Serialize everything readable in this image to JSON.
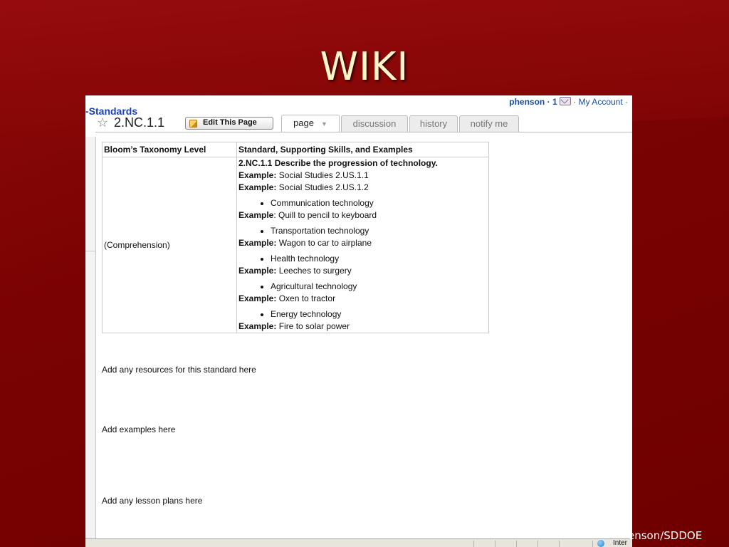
{
  "slide": {
    "title": "WIKI",
    "credit": "enson/SDDOE"
  },
  "wiki": {
    "user_bar": {
      "username": "phenson",
      "count": "· 1",
      "account": "· My Account ·"
    },
    "breadcrumb": "-Standards",
    "page_name": "2.NC.1.1",
    "edit_button": "Edit This Page",
    "tabs": [
      {
        "label": "page",
        "active": true
      },
      {
        "label": "discussion",
        "active": false
      },
      {
        "label": "history",
        "active": false
      },
      {
        "label": "notify me",
        "active": false
      }
    ],
    "table": {
      "headers": [
        "Bloom’s Taxonomy Level",
        "Standard, Supporting Skills, and Examples"
      ],
      "level": "(Comprehension)",
      "standard": "2.NC.1.1 Describe the progression of technology.",
      "examples_intro": [
        {
          "label": "Example:",
          "text": " Social Studies 2.US.1.1"
        },
        {
          "label": "Example:",
          "text": " Social Studies 2.US.1.2"
        }
      ],
      "items": [
        {
          "bullet": "Communication technology",
          "label": "Example",
          "text": ": Quill to pencil to keyboard"
        },
        {
          "bullet": "Transportation technology",
          "label": "Example:",
          "text": " Wagon to car to airplane"
        },
        {
          "bullet": "Health technology",
          "label": "Example:",
          "text": " Leeches to surgery"
        },
        {
          "bullet": "Agricultural technology",
          "label": "Example:",
          "text": " Oxen to tractor"
        },
        {
          "bullet": "Energy technology",
          "label": "Example:",
          "text": " Fire to solar power"
        }
      ]
    },
    "notes": {
      "resources": "Add any resources for this standard here",
      "examples": "Add examples here",
      "lesson_plans": "Add any lesson plans here"
    },
    "status_bar": {
      "zone": "Inter"
    }
  },
  "colors": {
    "slide_background": "#7a0202",
    "title_text": "#fff6c8",
    "link_blue": "#1a3fb8"
  }
}
